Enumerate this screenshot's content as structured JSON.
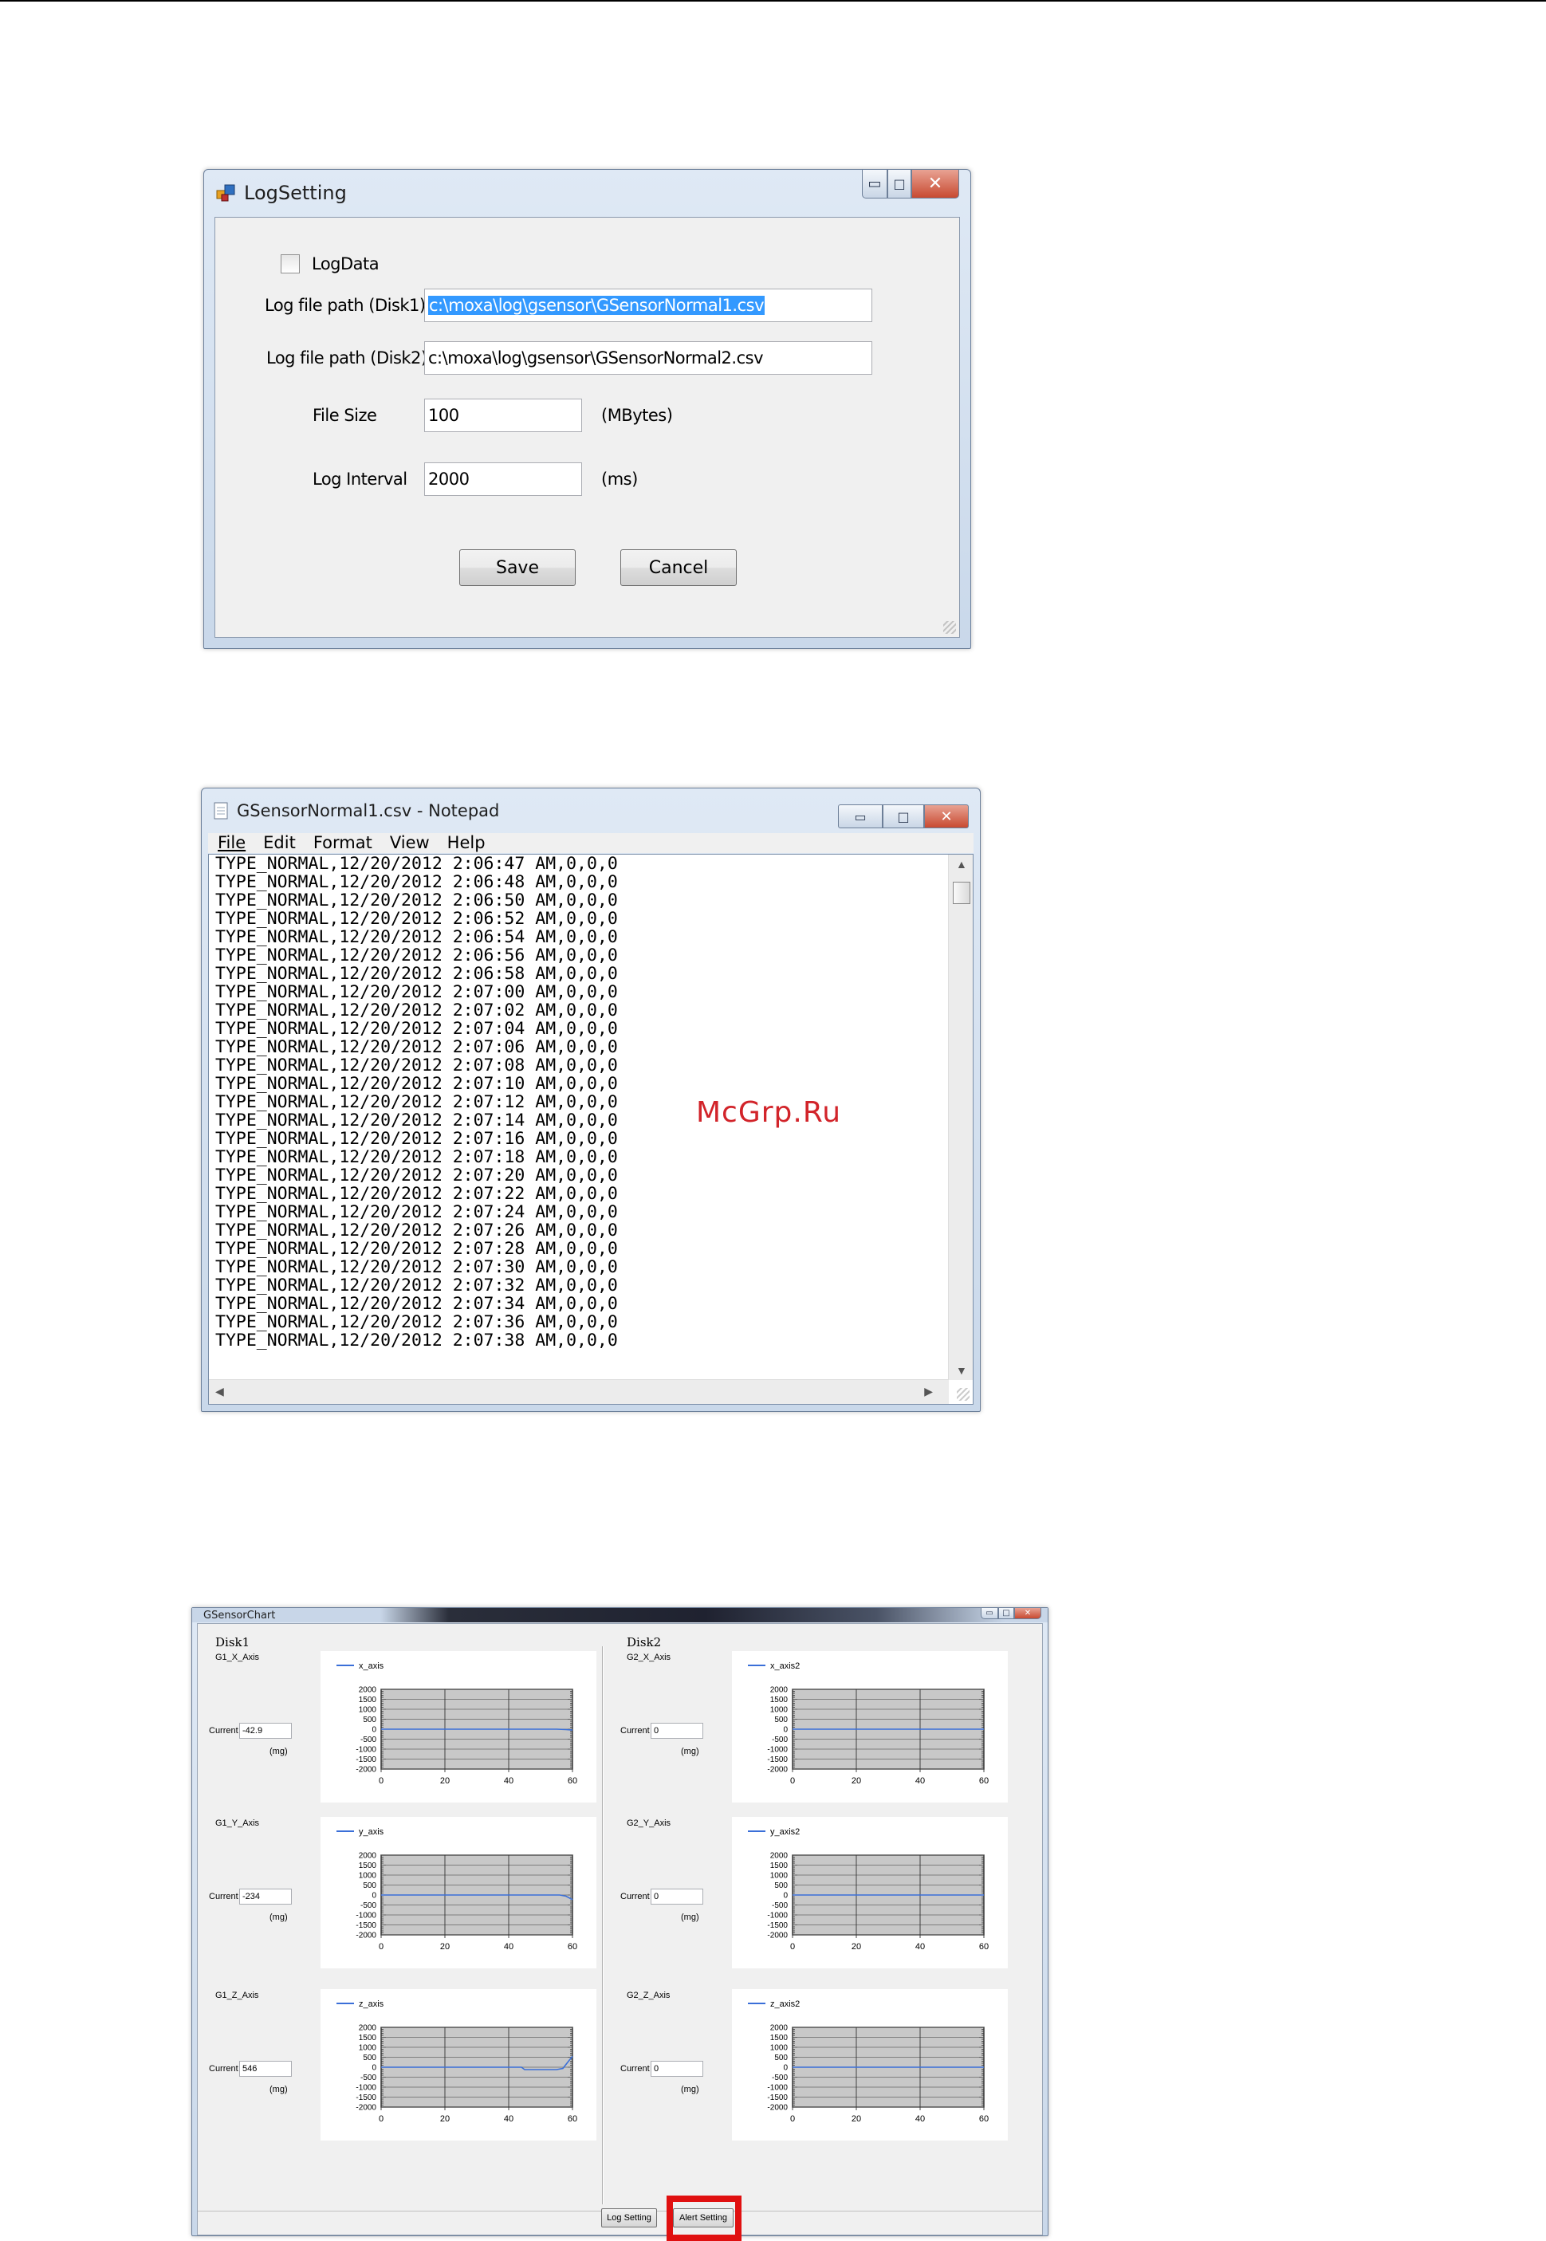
{
  "log_setting": {
    "title": "LogSetting",
    "log_data_label": "LogData",
    "disk1_label": "Log file path (Disk1)",
    "disk1_value": "c:\\moxa\\log\\gsensor\\GSensorNormal1.csv",
    "disk2_label": "Log file path (Disk2)",
    "disk2_value": "c:\\moxa\\log\\gsensor\\GSensorNormal2.csv",
    "file_size_label": "File Size",
    "file_size_value": "100",
    "file_size_unit": "(MBytes)",
    "log_interval_label": "Log Interval",
    "log_interval_value": "2000",
    "log_interval_unit": "(ms)",
    "save_label": "Save",
    "cancel_label": "Cancel"
  },
  "notepad": {
    "title": "GSensorNormal1.csv - Notepad",
    "menu": [
      "File",
      "Edit",
      "Format",
      "View",
      "Help"
    ],
    "lines": [
      "TYPE_NORMAL,12/20/2012 2:06:47 AM,0,0,0",
      "TYPE_NORMAL,12/20/2012 2:06:48 AM,0,0,0",
      "TYPE_NORMAL,12/20/2012 2:06:50 AM,0,0,0",
      "TYPE_NORMAL,12/20/2012 2:06:52 AM,0,0,0",
      "TYPE_NORMAL,12/20/2012 2:06:54 AM,0,0,0",
      "TYPE_NORMAL,12/20/2012 2:06:56 AM,0,0,0",
      "TYPE_NORMAL,12/20/2012 2:06:58 AM,0,0,0",
      "TYPE_NORMAL,12/20/2012 2:07:00 AM,0,0,0",
      "TYPE_NORMAL,12/20/2012 2:07:02 AM,0,0,0",
      "TYPE_NORMAL,12/20/2012 2:07:04 AM,0,0,0",
      "TYPE_NORMAL,12/20/2012 2:07:06 AM,0,0,0",
      "TYPE_NORMAL,12/20/2012 2:07:08 AM,0,0,0",
      "TYPE_NORMAL,12/20/2012 2:07:10 AM,0,0,0",
      "TYPE_NORMAL,12/20/2012 2:07:12 AM,0,0,0",
      "TYPE_NORMAL,12/20/2012 2:07:14 AM,0,0,0",
      "TYPE_NORMAL,12/20/2012 2:07:16 AM,0,0,0",
      "TYPE_NORMAL,12/20/2012 2:07:18 AM,0,0,0",
      "TYPE_NORMAL,12/20/2012 2:07:20 AM,0,0,0",
      "TYPE_NORMAL,12/20/2012 2:07:22 AM,0,0,0",
      "TYPE_NORMAL,12/20/2012 2:07:24 AM,0,0,0",
      "TYPE_NORMAL,12/20/2012 2:07:26 AM,0,0,0",
      "TYPE_NORMAL,12/20/2012 2:07:28 AM,0,0,0",
      "TYPE_NORMAL,12/20/2012 2:07:30 AM,0,0,0",
      "TYPE_NORMAL,12/20/2012 2:07:32 AM,0,0,0",
      "TYPE_NORMAL,12/20/2012 2:07:34 AM,0,0,0",
      "TYPE_NORMAL,12/20/2012 2:07:36 AM,0,0,0",
      "TYPE_NORMAL,12/20/2012 2:07:38 AM,0,0,0"
    ]
  },
  "watermark": "McGrp.Ru",
  "gsensor": {
    "title": "GSensorChart",
    "disk1_label": "Disk1",
    "disk2_label": "Disk2",
    "current_label": "Current",
    "unit_label": "(mg)",
    "log_setting_button": "Log Setting",
    "alert_setting_button": "Alert Setting",
    "panels": [
      {
        "axis_label": "G1_X_Axis",
        "current": "-42.9"
      },
      {
        "axis_label": "G1_Y_Axis",
        "current": "-234"
      },
      {
        "axis_label": "G1_Z_Axis",
        "current": "546"
      },
      {
        "axis_label": "G2_X_Axis",
        "current": "0"
      },
      {
        "axis_label": "G2_Y_Axis",
        "current": "0"
      },
      {
        "axis_label": "G2_Z_Axis",
        "current": "0"
      }
    ],
    "highlight_color": "#e01010",
    "line_color": "#3a6fd8"
  },
  "chart_data": [
    {
      "type": "line",
      "series": [
        {
          "name": "x_axis",
          "x": [
            0,
            55,
            58,
            60
          ],
          "values": [
            0,
            0,
            -20,
            -42.9
          ]
        }
      ],
      "xlim": [
        0,
        60
      ],
      "ylim": [
        -2000,
        2000
      ],
      "xticks": [
        0,
        20,
        40,
        60
      ],
      "yticks": [
        "2000",
        "1500",
        "1000",
        "500",
        "0",
        "-500",
        "-1000",
        "-1500",
        "-2000"
      ],
      "grid": true,
      "legend": "top-left"
    },
    {
      "type": "line",
      "series": [
        {
          "name": "y_axis",
          "x": [
            0,
            56,
            58,
            60
          ],
          "values": [
            0,
            0,
            -60,
            -234
          ]
        }
      ],
      "xlim": [
        0,
        60
      ],
      "ylim": [
        -2000,
        2000
      ],
      "xticks": [
        0,
        20,
        40,
        60
      ],
      "yticks": [
        "2000",
        "1500",
        "1000",
        "500",
        "0",
        "-500",
        "-1000",
        "-1500",
        "-2000"
      ],
      "grid": true,
      "legend": "top-left"
    },
    {
      "type": "line",
      "series": [
        {
          "name": "z_axis",
          "x": [
            0,
            44,
            45,
            55,
            57,
            59,
            60
          ],
          "values": [
            0,
            0,
            -120,
            -120,
            -60,
            350,
            546
          ]
        }
      ],
      "xlim": [
        0,
        60
      ],
      "ylim": [
        -2000,
        2000
      ],
      "xticks": [
        0,
        20,
        40,
        60
      ],
      "yticks": [
        "2000",
        "1500",
        "1000",
        "500",
        "0",
        "-500",
        "-1000",
        "-1500",
        "-2000"
      ],
      "grid": true,
      "legend": "top-left"
    },
    {
      "type": "line",
      "series": [
        {
          "name": "x_axis2",
          "x": [
            0,
            60
          ],
          "values": [
            0,
            0
          ]
        }
      ],
      "xlim": [
        0,
        60
      ],
      "ylim": [
        -2000,
        2000
      ],
      "xticks": [
        0,
        20,
        40,
        60
      ],
      "yticks": [
        "2000",
        "1500",
        "1000",
        "500",
        "0",
        "-500",
        "-1000",
        "-1500",
        "-2000"
      ],
      "grid": true,
      "legend": "top-left"
    },
    {
      "type": "line",
      "series": [
        {
          "name": "y_axis2",
          "x": [
            0,
            60
          ],
          "values": [
            0,
            0
          ]
        }
      ],
      "xlim": [
        0,
        60
      ],
      "ylim": [
        -2000,
        2000
      ],
      "xticks": [
        0,
        20,
        40,
        60
      ],
      "yticks": [
        "2000",
        "1500",
        "1000",
        "500",
        "0",
        "-500",
        "-1000",
        "-1500",
        "-2000"
      ],
      "grid": true,
      "legend": "top-left"
    },
    {
      "type": "line",
      "series": [
        {
          "name": "z_axis2",
          "x": [
            0,
            60
          ],
          "values": [
            0,
            0
          ]
        }
      ],
      "xlim": [
        0,
        60
      ],
      "ylim": [
        -2000,
        2000
      ],
      "xticks": [
        0,
        20,
        40,
        60
      ],
      "yticks": [
        "2000",
        "1500",
        "1000",
        "500",
        "0",
        "-500",
        "-1000",
        "-1500",
        "-2000"
      ],
      "grid": true,
      "legend": "top-left"
    }
  ]
}
